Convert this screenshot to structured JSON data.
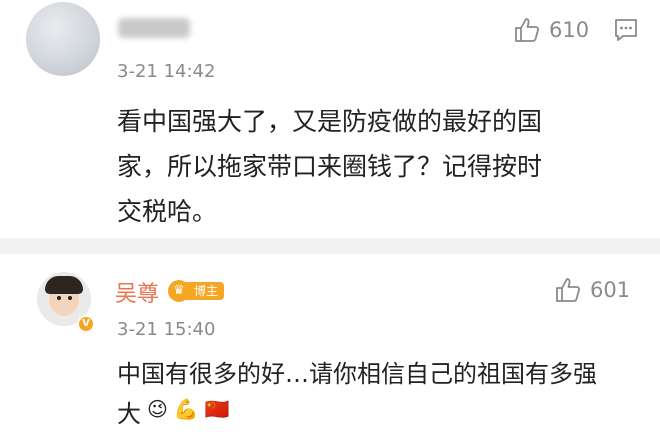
{
  "comments": [
    {
      "username": "",
      "time": "3-21 14:42",
      "like_count": "610",
      "text": "看中国强大了，又是防疫做的最好的国\n家，所以拖家带口来圈钱了？记得按时\n交税哈。"
    },
    {
      "username": "吴尊",
      "badge": "博主",
      "time": "3-21 15:40",
      "like_count": "601",
      "text": "中国有很多的好…请你相信自己的祖国有多强\n大",
      "emojis": [
        "😉",
        "💪",
        "🇨🇳"
      ]
    }
  ],
  "icons": {
    "like": "thumbs-up-icon",
    "reply": "comment-bubble-icon",
    "verified": "verified-v-icon",
    "badge": "crown-icon"
  },
  "colors": {
    "username": "#eb7350",
    "badge": "#f5a623",
    "muted": "#8a8a8a",
    "separator": "#f2f2f2"
  }
}
